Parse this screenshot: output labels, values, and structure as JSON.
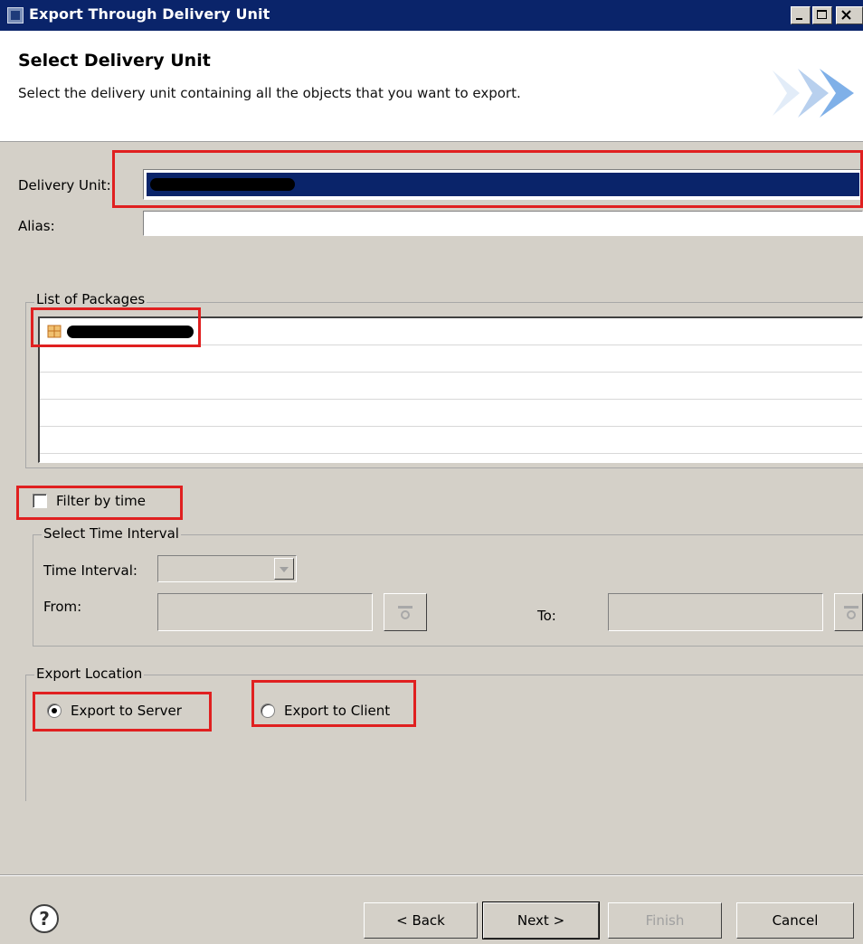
{
  "window": {
    "title": "Export Through Delivery Unit"
  },
  "header": {
    "title": "Select Delivery Unit",
    "description": "Select the delivery unit containing all the objects that you want to export."
  },
  "form": {
    "delivery_unit_label": "Delivery Unit:",
    "alias_label": "Alias:",
    "alias_value": ""
  },
  "packages": {
    "group_label": "List of Packages"
  },
  "filter": {
    "checkbox_label": "Filter by time",
    "checked": false,
    "interval_group_label": "Select Time Interval",
    "time_interval_label": "Time Interval:",
    "from_label": "From:",
    "to_label": "To:"
  },
  "export_location": {
    "group_label": "Export Location",
    "server_label": "Export to Server",
    "client_label": "Export to Client",
    "selected": "server"
  },
  "buttons": {
    "back": "< Back",
    "next": "Next >",
    "finish": "Finish",
    "cancel": "Cancel"
  },
  "colors": {
    "title_bar": "#0a246a",
    "selection": "#0a246a",
    "annotation_red": "#e02020",
    "dialog_bg": "#d4d0c8"
  }
}
